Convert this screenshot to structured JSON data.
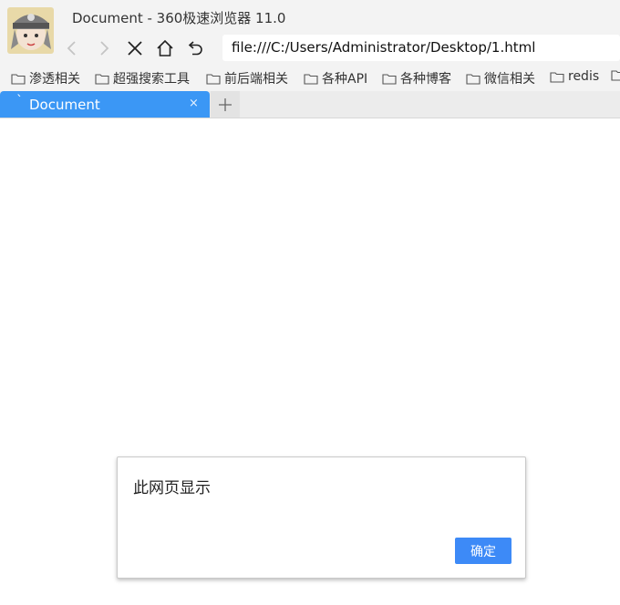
{
  "window": {
    "title": "Document - 360极速浏览器 11.0"
  },
  "toolbar": {
    "url": "file:///C:/Users/Administrator/Desktop/1.html",
    "icons": [
      "back-icon",
      "forward-icon",
      "stop-icon",
      "home-icon",
      "undo-icon"
    ]
  },
  "bookmarks": [
    {
      "label": "渗透相关"
    },
    {
      "label": "超强搜索工具"
    },
    {
      "label": "前后端相关"
    },
    {
      "label": "各种API"
    },
    {
      "label": "各种博客"
    },
    {
      "label": "微信相关"
    },
    {
      "label": "redis"
    }
  ],
  "tabs": [
    {
      "label": "Document",
      "tick": "`",
      "close": "×",
      "active": true
    }
  ],
  "new_tab_label": "+",
  "dialog": {
    "message": "此网页显示",
    "ok_label": "确定"
  },
  "colors": {
    "accent": "#3b97f5",
    "button": "#3d8af7"
  }
}
